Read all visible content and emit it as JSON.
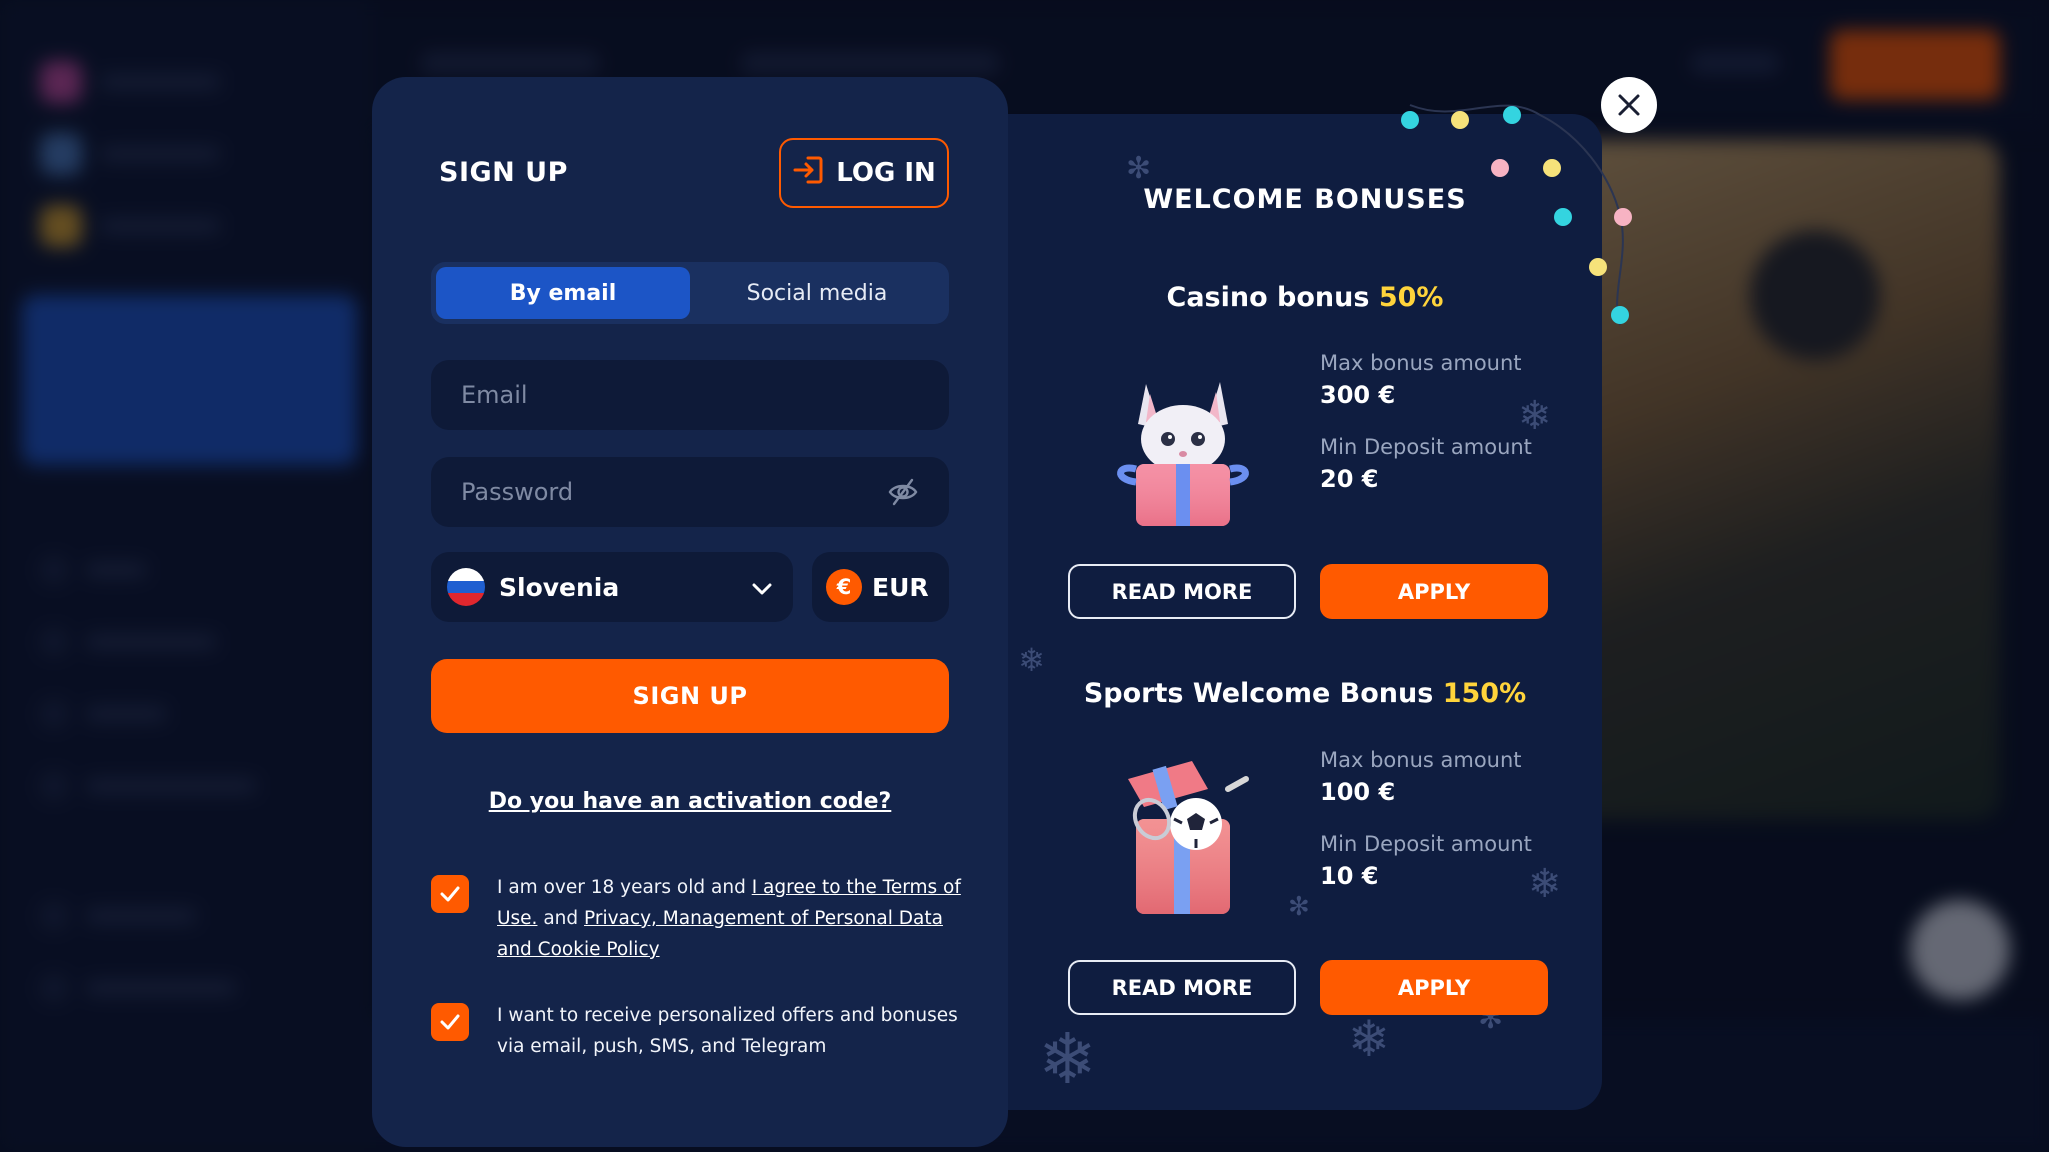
{
  "signup": {
    "title": "SIGN UP",
    "login_label": "LOG IN",
    "tabs": [
      {
        "label": "By email",
        "active": true
      },
      {
        "label": "Social media",
        "active": false
      }
    ],
    "email_placeholder": "Email",
    "password_placeholder": "Password",
    "country": "Slovenia",
    "currency": "EUR",
    "currency_symbol": "€",
    "submit_label": "SIGN UP",
    "activation_link": "Do you have an activation code?",
    "consent_terms": {
      "prefix": "I am over 18 years old and ",
      "terms_link": "I agree to the Terms of Use.",
      "middle": " and ",
      "privacy_link": "Privacy, Management of Personal Data and Cookie Policy",
      "checked": true
    },
    "consent_offers": {
      "text": "I want to receive personalized offers and bonuses via email, push, SMS, and Telegram",
      "checked": true
    }
  },
  "bonuses": {
    "title": "WELCOME BONUSES",
    "items": [
      {
        "name": "Casino bonus",
        "percent": "50%",
        "max_label": "Max bonus amount",
        "max_value": "300 €",
        "min_label": "Min Deposit amount",
        "min_value": "20 €",
        "read_more": "READ MORE",
        "apply": "APPLY"
      },
      {
        "name": "Sports Welcome Bonus",
        "percent": "150%",
        "max_label": "Max bonus amount",
        "max_value": "100 €",
        "min_label": "Min Deposit amount",
        "min_value": "10 €",
        "read_more": "READ MORE",
        "apply": "APPLY"
      }
    ]
  },
  "colors": {
    "accent": "#ff5a00",
    "panel": "#14244a",
    "bonus_panel": "#0f1d40",
    "tab_active": "#1c55c6",
    "percent": "#ffd43b"
  },
  "icons": {
    "login": "login-arrow-icon",
    "password_toggle": "eye-off-icon",
    "dropdown": "chevron-down-icon",
    "checkbox": "checkmark-icon",
    "close": "close-icon"
  }
}
